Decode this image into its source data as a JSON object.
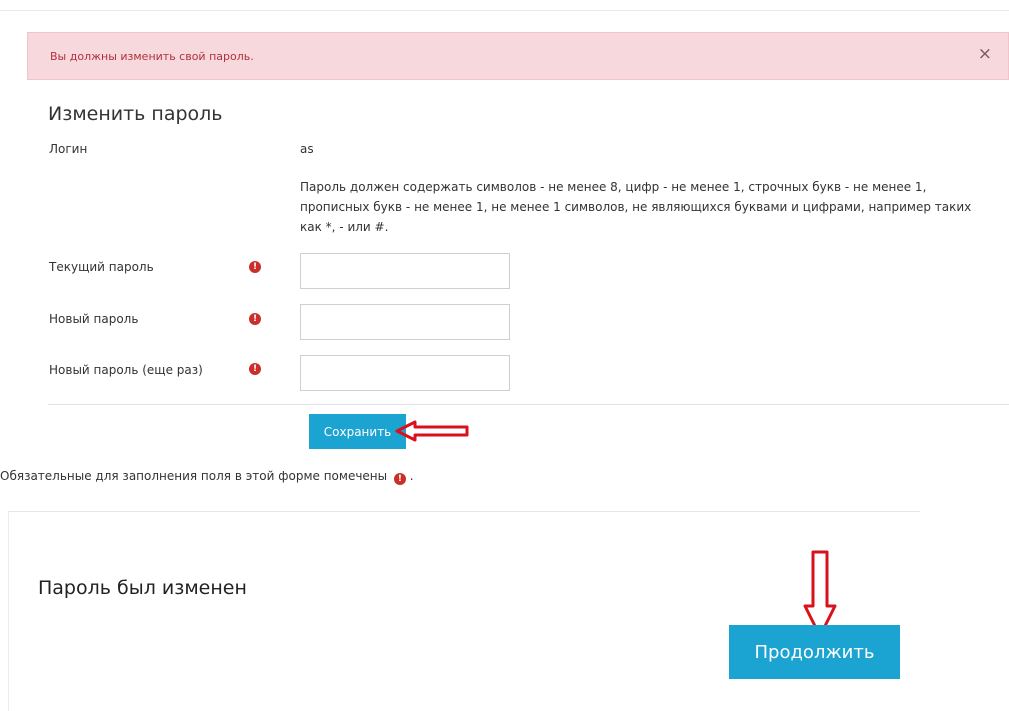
{
  "alert": {
    "message": "Вы должны изменить свой пароль.",
    "close_symbol": "×"
  },
  "form": {
    "title": "Изменить пароль",
    "login_label": "Логин",
    "login_value": "as",
    "password_rules": "Пароль должен содержать символов - не менее 8, цифр - не менее 1, строчных букв - не менее 1, прописных букв - не менее 1, не менее 1 символов, не являющихся буквами и цифрами, например таких как *, - или #.",
    "fields": [
      {
        "label": "Текущий пароль",
        "value": ""
      },
      {
        "label": "Новый пароль",
        "value": ""
      },
      {
        "label": "Новый пароль (еще раз)",
        "value": ""
      }
    ],
    "required_icon": "!",
    "save_label": "Сохранить",
    "required_note": "Обязательные для заполнения поля в этой форме помечены",
    "required_note_tail": "."
  },
  "result": {
    "message": "Пароль был изменен",
    "continue_label": "Продолжить"
  },
  "colors": {
    "accent": "#1ba3d1",
    "alert_bg": "#f7d9dd",
    "alert_text": "#b0303a",
    "required": "#c9302c",
    "annotation_arrow": "#d9111b"
  }
}
